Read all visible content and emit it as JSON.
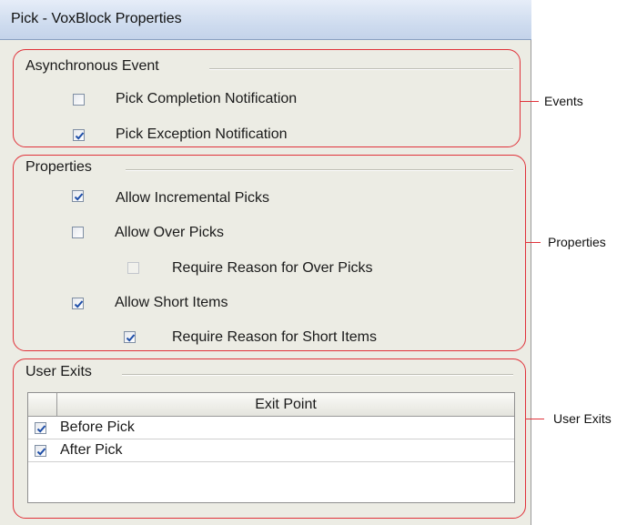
{
  "window": {
    "title": "Pick - VoxBlock Properties"
  },
  "async_event": {
    "title": "Asynchronous Event",
    "items": [
      {
        "label": "Pick Completion Notification",
        "checked": false,
        "enabled": true
      },
      {
        "label": "Pick Exception Notification",
        "checked": true,
        "enabled": true
      }
    ]
  },
  "properties": {
    "title": "Properties",
    "items": [
      {
        "label": "Allow Incremental Picks",
        "checked": true,
        "enabled": true
      },
      {
        "label": "Allow Over Picks",
        "checked": false,
        "enabled": true
      },
      {
        "label": "Require Reason for Over Picks",
        "checked": false,
        "enabled": false
      },
      {
        "label": "Allow Short Items",
        "checked": true,
        "enabled": true
      },
      {
        "label": "Require Reason for Short Items",
        "checked": true,
        "enabled": true
      }
    ]
  },
  "user_exits": {
    "title": "User Exits",
    "table": {
      "columns": [
        "",
        "Exit Point"
      ],
      "rows": [
        {
          "label": "Before Pick",
          "checked": true
        },
        {
          "label": "After Pick",
          "checked": true
        }
      ]
    }
  },
  "callouts": {
    "events": "Events",
    "properties": "Properties",
    "user_exits": "User Exits"
  },
  "colors": {
    "callout": "#e0323a",
    "check": "#1f4fa8",
    "dialog_bg": "#ecece4",
    "titlebar": "#cfdcef"
  }
}
